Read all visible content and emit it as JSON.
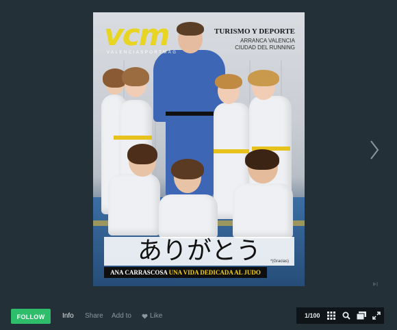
{
  "cover": {
    "logo": "vcm",
    "logo_sub": "VALENCIASPORTMAG",
    "headline_title": "TURISMO Y DEPORTE",
    "headline_line1": "ARRANCA VALENCIA",
    "headline_line2": "CIUDAD DEL RUNNING",
    "big_title": "ありがとう",
    "big_title_note": "*(Gracias)",
    "tagline_name": "ANA CARRASCOSA ",
    "tagline_highlight": "UNA VIDA DEDICADA AL JUDO"
  },
  "bottom_bar": {
    "follow_label": "FOLLOW",
    "info_label": "Info",
    "share_label": "Share",
    "addto_label": "Add to",
    "like_label": "Like"
  },
  "toolbar": {
    "page_indicator": "1/100",
    "tools": [
      "grid-icon",
      "search-icon",
      "pages-icon",
      "fullscreen-icon"
    ]
  },
  "colors": {
    "background": "#243038",
    "follow_green": "#2ebd6b",
    "logo_yellow": "#e8d422"
  }
}
